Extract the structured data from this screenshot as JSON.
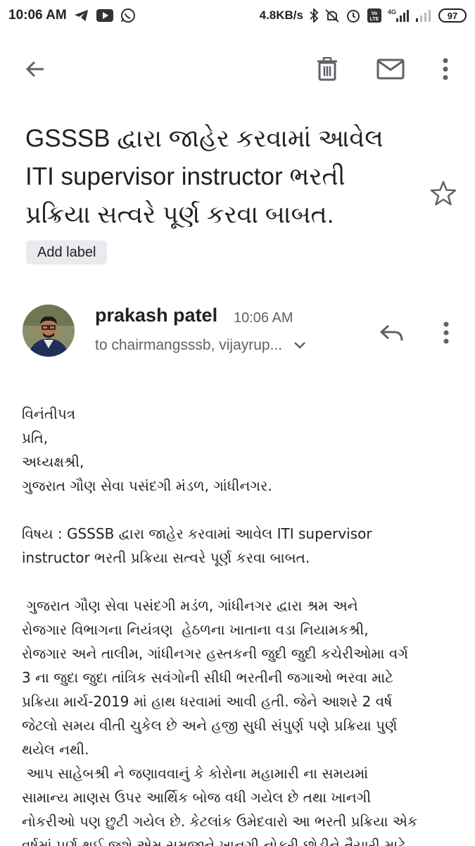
{
  "status": {
    "time": "10:06 AM",
    "speed": "4.8KB/s",
    "network": "4G",
    "battery": "97"
  },
  "toolbar": {
    "back": "back-icon",
    "delete": "delete-icon",
    "mail": "mark-unread-icon",
    "more": "more-vert-icon"
  },
  "email": {
    "subject_lines": [
      "GSSSB દ્વારા જાહેર કરવામાં આવેલ",
      "ITI supervisor instructor ભરતી",
      "પ્રક્રિયા સત્વરે પૂર્ણ કરવા બાબત."
    ],
    "add_label": "Add label",
    "sender_name": "prakash patel",
    "sent_time": "10:06 AM",
    "recipients": "to chairmangsssb, vijayrup..."
  },
  "body": {
    "address_lines": [
      "વિનંતીપત્ર",
      "પ્રતિ,",
      "અધ્યક્ષશ્રી,",
      "ગુજરાત ગૌણ સેવા પસંદગી મંડળ, ગાંધીનગર."
    ],
    "subject_lines": [
      "વિષય : GSSSB દ્વારા જાહેર કરવામાં આવેલ ITI supervisor",
      "instructor ભરતી પ્રક્રિયા સત્વરે પૂર્ણ કરવા બાબત."
    ],
    "paragraph1": [
      " ગુજરાત ગૌણ સેવા પસંદગી મડંળ, ગાંધીનગર દ્વારા શ્રમ અને",
      "રોજગાર વિભાગના નિયંત્રણ  હેઠળના ખાતાના વડા નિયામકશ્રી,",
      "રોજગાર અને તાલીમ, ગાંધીનગર હસ્તકની જુદી જુદી કચેરીઓમા વર્ગ",
      "3 ના જુદા જુદા તાંત્રિક સવંગોની સીધી ભરતીની જગાઓ ભરવા માટે",
      "પ્રક્રિયા માર્ચ-2019 માં હાથ ધરવામાં આવી હતી. જેને આશરે 2 વર્ષ",
      "જેટલો સમય વીતી ચુકેલ છે અને હજી સુધી સંપુર્ણ પણે પ્રક્રિયા પુર્ણ",
      "થયેલ નથી."
    ],
    "paragraph2": [
      " આપ સાહેબશ્રી ને જણાવવાનું કે કોરોના મહામારી ના સમયમાં",
      "સામાન્ય માણસ ઉપર આર્થિક બોજ વધી ગયેલ છે તથા ખાનગી",
      "નોકરીઓ પણ છુટી ગયેલ છે. કેટલાંક ઉમેદવારો આ ભરતી પ્રક્રિયા એક",
      "વર્ષમાં પૂર્ણ થઈ જશે એમ સમજીને ખાનગી નોકરી છોડીને તૈયારી માટે"
    ]
  }
}
